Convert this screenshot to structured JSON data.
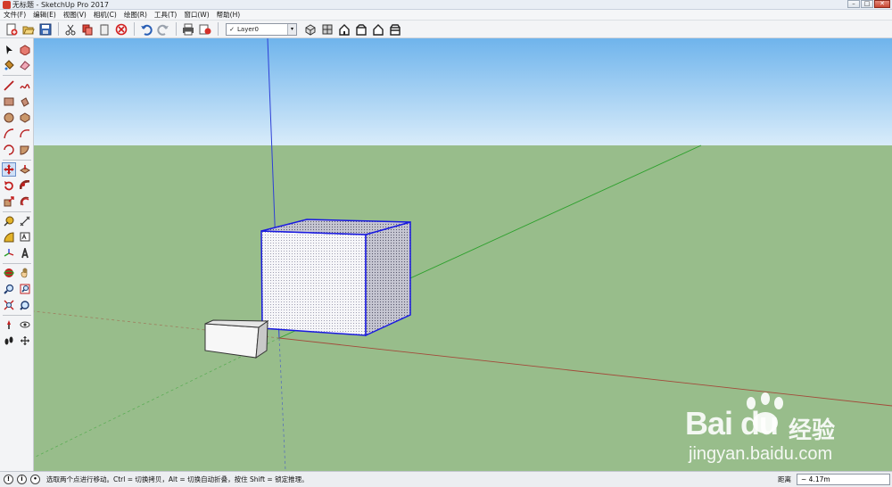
{
  "window": {
    "title": "无标题 - SketchUp Pro 2017",
    "minimize_glyph": "–",
    "maximize_glyph": "□",
    "close_glyph": "✕"
  },
  "menu": {
    "items": [
      "文件(F)",
      "编辑(E)",
      "视图(V)",
      "相机(C)",
      "绘图(R)",
      "工具(T)",
      "窗口(W)",
      "帮助(H)"
    ]
  },
  "toolbar": {
    "layer_check": "✓",
    "layer_name": "Layer0",
    "layer_dropdown": "▾",
    "icons": [
      "new-icon",
      "open-icon",
      "save-icon",
      "cut-icon",
      "copy-icon",
      "paste-icon",
      "erase-icon",
      "undo-icon",
      "redo-icon",
      "print-icon",
      "model-info-icon",
      "iso-view-icon",
      "top-view-icon",
      "front-view-icon",
      "right-view-icon",
      "back-view-icon",
      "left-view-icon"
    ]
  },
  "palette": {
    "icons": [
      "select-icon",
      "make-component-icon",
      "paint-bucket-icon",
      "eraser-icon",
      "line-icon",
      "freehand-icon",
      "rectangle-icon",
      "rotated-rectangle-icon",
      "circle-icon",
      "polygon-icon",
      "arc-icon",
      "two-point-arc-icon",
      "three-point-arc-icon",
      "pie-icon",
      "move-icon",
      "push-pull-icon",
      "rotate-icon",
      "follow-me-icon",
      "scale-icon",
      "offset-icon",
      "tape-measure-icon",
      "dimension-icon",
      "protractor-icon",
      "text-icon",
      "axes-icon",
      "3d-text-icon",
      "orbit-icon",
      "pan-icon",
      "zoom-icon",
      "zoom-window-icon",
      "zoom-extents-icon",
      "previous-view-icon",
      "position-camera-icon",
      "look-around-icon",
      "walk-icon",
      "section-plane-icon"
    ]
  },
  "status": {
    "text": "选取两个点进行移动。Ctrl = 切换拷贝，Alt = 切换自动折叠，按住 Shift = 锁定推理。",
    "measure_label": "距离",
    "measure_value": "~ 4.17m",
    "icons": [
      "geo-location-icon",
      "info-icon",
      "user-icon"
    ]
  },
  "watermark": {
    "brand": "Bai du",
    "jingyan": "经验",
    "url": "jingyan.baidu.com"
  },
  "colors": {
    "sky_top": "#6fb4ec",
    "sky_bottom": "#d9ecfa",
    "ground": "#98bd8b",
    "axis_red": "#a34a3a",
    "axis_green": "#2ca02c",
    "axis_blue": "#2d3fd6",
    "selection_blue": "#1a1ae0"
  }
}
